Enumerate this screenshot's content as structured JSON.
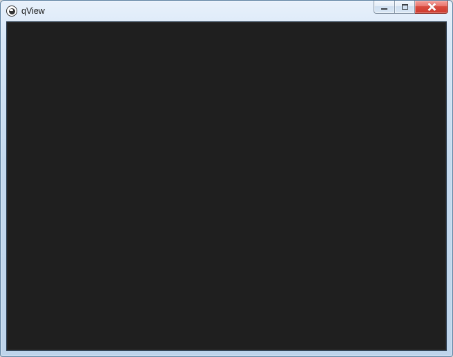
{
  "window": {
    "title": "qView"
  },
  "icons": {
    "app": "qview-app-icon",
    "minimize": "minimize-icon",
    "maximize": "maximize-icon",
    "close": "close-icon"
  },
  "colors": {
    "client_background": "#1f1f1f",
    "frame_gradient_top": "#e8f1fb",
    "frame_gradient_bottom": "#bdd4eb",
    "close_button": "#d84b3f"
  }
}
